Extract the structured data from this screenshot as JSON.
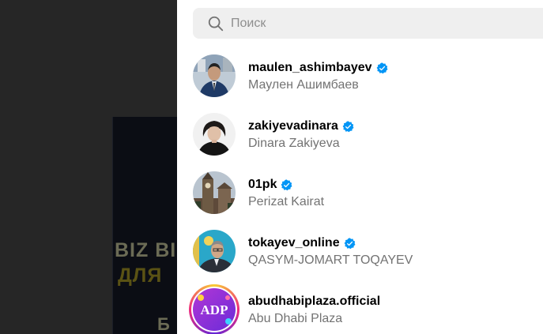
{
  "search": {
    "placeholder": "Поиск",
    "value": ""
  },
  "background": {
    "line1": "BIZ BI",
    "line2": "ДЛЯ",
    "line3": "Б"
  },
  "results": [
    {
      "username": "maulen_ashimbayev",
      "full_name": "Маулен Ашимбаев",
      "verified": true,
      "avatar": "man-in-suit"
    },
    {
      "username": "zakiyevadinara",
      "full_name": "Dinara Zakiyeva",
      "verified": true,
      "avatar": "woman-portrait"
    },
    {
      "username": "01pk",
      "full_name": "Perizat Kairat",
      "verified": true,
      "avatar": "clock-tower"
    },
    {
      "username": "tokayev_online",
      "full_name": "QASYM-JOMART TOQAYEV",
      "verified": true,
      "avatar": "man-with-flag"
    },
    {
      "username": "abudhabiplaza.official",
      "full_name": "Abu Dhabi Plaza",
      "verified": false,
      "avatar": "adp-logo",
      "logo_text": "ADP"
    }
  ],
  "colors": {
    "verified": "#0095f6",
    "panel_bg": "#ffffff",
    "search_bg": "#efefef",
    "backdrop": "#262626"
  }
}
